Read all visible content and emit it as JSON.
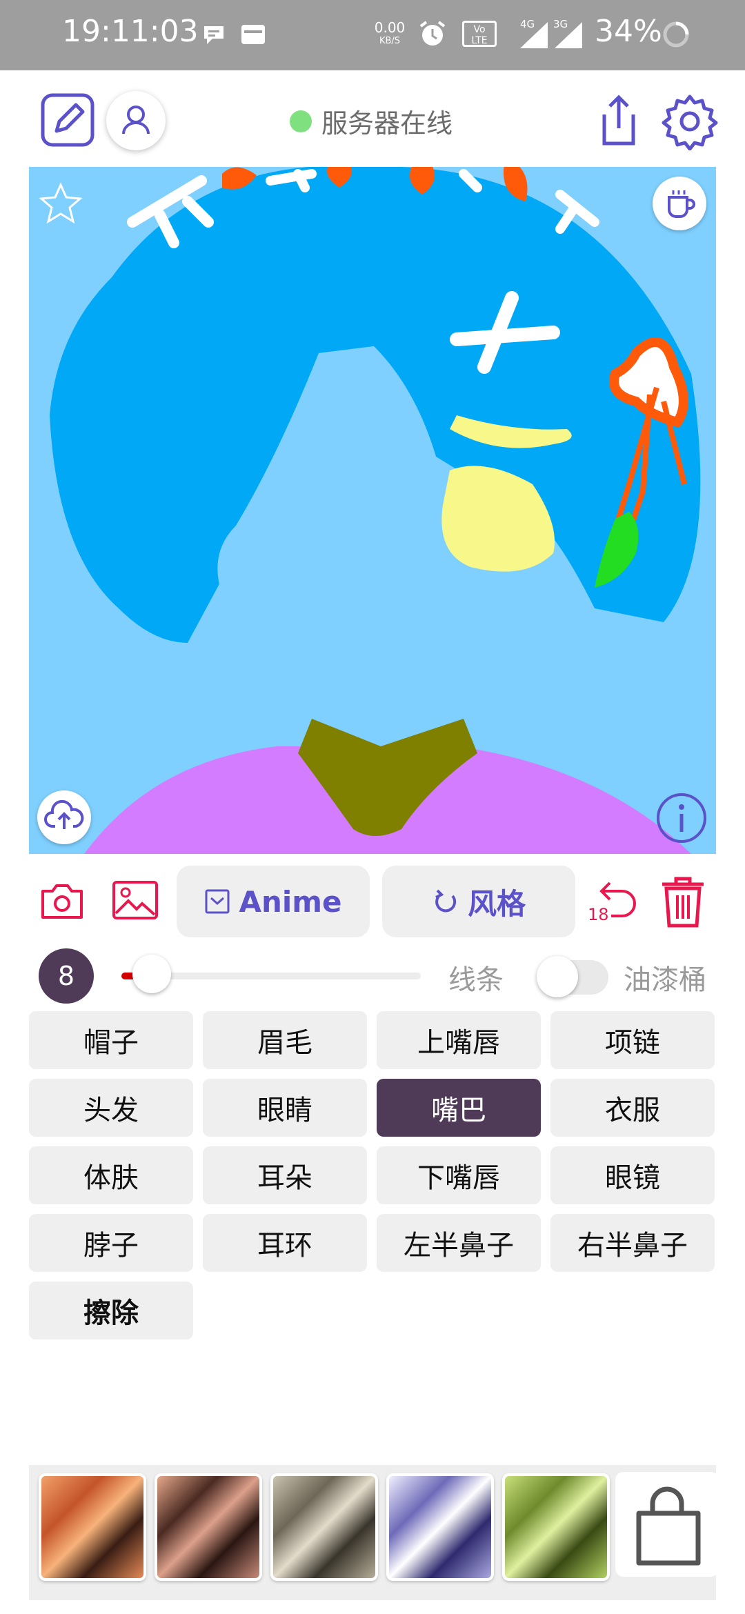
{
  "status_bar": {
    "time": "19:11:03",
    "net_speed_value": "0.00",
    "net_speed_unit": "KB/S",
    "volte": "Vo LTE",
    "sim1": "4G",
    "sim2": "3G",
    "battery": "34%"
  },
  "app_bar": {
    "server_status": "服务器在线",
    "status_color": "#7ee07e"
  },
  "toolbar": {
    "model_label": "Anime",
    "style_label": "风格",
    "undo_count": "18"
  },
  "brush": {
    "size": "8",
    "slider_fraction": 0.05,
    "lines_label": "线条",
    "bucket_label": "油漆桶",
    "bucket_enabled": false
  },
  "parts": {
    "items": [
      {
        "label": "帽子"
      },
      {
        "label": "眉毛"
      },
      {
        "label": "上嘴唇"
      },
      {
        "label": "项链"
      },
      {
        "label": "头发"
      },
      {
        "label": "眼睛"
      },
      {
        "label": "嘴巴"
      },
      {
        "label": "衣服"
      },
      {
        "label": "体肤"
      },
      {
        "label": "耳朵"
      },
      {
        "label": "下嘴唇"
      },
      {
        "label": "眼镜"
      },
      {
        "label": "脖子"
      },
      {
        "label": "耳环"
      },
      {
        "label": "左半鼻子"
      },
      {
        "label": "右半鼻子"
      },
      {
        "label": "擦除"
      }
    ],
    "selected": "嘴巴"
  },
  "colors": {
    "accent": "#5b52c9",
    "danger": "#e8184f",
    "selected_part": "#4f3a58",
    "canvas_bg": "#7fd0ff",
    "hair": "#00a8f5",
    "skin": "#7fd0ff",
    "eye": "#f8f88a",
    "neck": "#808000",
    "clothes": "#d47cff",
    "ribbon": "#ff5a0a",
    "hair_clip": "#ffffff",
    "earring": "#22dd22"
  },
  "style_thumbnails": [
    "orange",
    "brown",
    "gray",
    "blue",
    "green"
  ]
}
